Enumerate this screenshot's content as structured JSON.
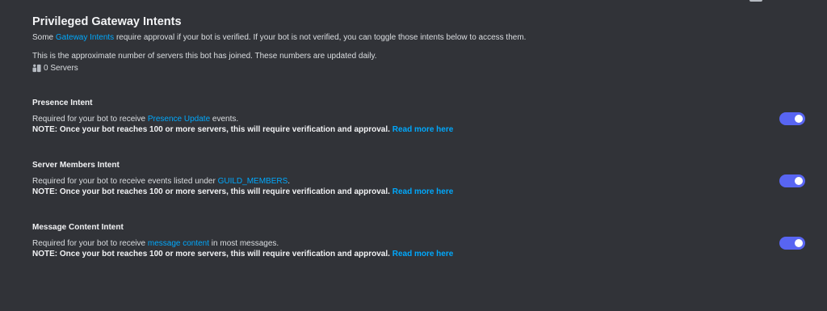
{
  "header": {
    "title": "Privileged Gateway Intents",
    "desc_prefix": "Some ",
    "desc_link": "Gateway Intents",
    "desc_suffix": " require approval if your bot is verified. If your bot is not verified, you can toggle those intents below to access them.",
    "approx_note": "This is the approximate number of servers this bot has joined. These numbers are updated daily.",
    "server_count": "0 Servers"
  },
  "intents": [
    {
      "title": "Presence Intent",
      "desc_prefix": "Required for your bot to receive ",
      "desc_link": "Presence Update",
      "desc_suffix": " events.",
      "note": "NOTE: Once your bot reaches 100 or more servers, this will require verification and approval.",
      "note_link": "Read more here",
      "enabled": true
    },
    {
      "title": "Server Members Intent",
      "desc_prefix": "Required for your bot to receive events listed under ",
      "desc_link": "GUILD_MEMBERS",
      "desc_suffix": ".",
      "note": "NOTE: Once your bot reaches 100 or more servers, this will require verification and approval.",
      "note_link": "Read more here",
      "enabled": true
    },
    {
      "title": "Message Content Intent",
      "desc_prefix": "Required for your bot to receive ",
      "desc_link": "message content",
      "desc_suffix": " in most messages.",
      "note": "NOTE: Once your bot reaches 100 or more servers, this will require verification and approval.",
      "note_link": "Read more here",
      "enabled": true
    }
  ],
  "colors": {
    "background": "#313338",
    "link": "#00a8fc",
    "toggle_on": "#5865f2"
  }
}
